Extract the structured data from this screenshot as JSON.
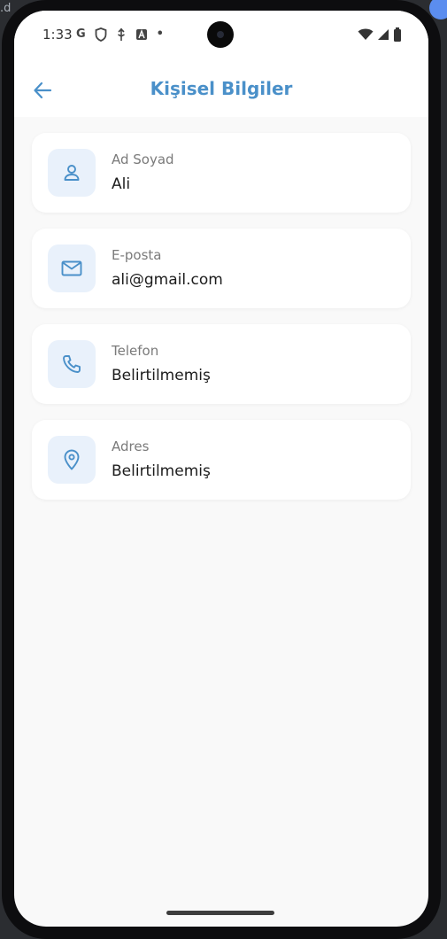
{
  "status_bar": {
    "time": "1:33",
    "left_icons": [
      "G",
      "shield-icon",
      "usb-icon",
      "A",
      "•"
    ]
  },
  "app_bar": {
    "title": "Kişisel Bilgiler"
  },
  "cards": [
    {
      "label": "Ad Soyad",
      "value": "Ali",
      "icon": "person-icon"
    },
    {
      "label": "E-posta",
      "value": "ali@gmail.com",
      "icon": "mail-icon"
    },
    {
      "label": "Telefon",
      "value": "Belirtilmemiş",
      "icon": "phone-icon"
    },
    {
      "label": "Adres",
      "value": "Belirtilmemiş",
      "icon": "location-pin-icon"
    }
  ],
  "colors": {
    "accent": "#4a90c9",
    "icon_bg": "#e9f1fb",
    "background": "#f9f9f9"
  },
  "desktop": {
    "corner_text": ".d"
  }
}
